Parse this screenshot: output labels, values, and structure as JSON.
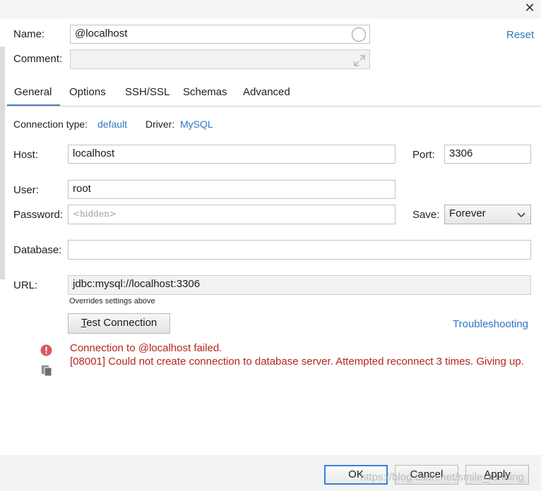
{
  "window": {
    "close": "✕"
  },
  "name": {
    "label": "Name:",
    "value": "@localhost"
  },
  "comment": {
    "label": "Comment:",
    "value": ""
  },
  "reset": "Reset",
  "tabs": [
    "General",
    "Options",
    "SSH/SSL",
    "Schemas",
    "Advanced"
  ],
  "connection": {
    "type_label": "Connection type:",
    "type_value": "default",
    "driver_label": "Driver:",
    "driver_value": "MySQL"
  },
  "host": {
    "label": "Host:",
    "value": "localhost"
  },
  "port": {
    "label": "Port:",
    "value": "3306"
  },
  "user": {
    "label": "User:",
    "value": "root"
  },
  "password": {
    "label": "Password:",
    "placeholder": "<hidden>"
  },
  "save": {
    "label": "Save:",
    "selected": "Forever"
  },
  "database": {
    "label": "Database:",
    "value": ""
  },
  "url": {
    "label": "URL:",
    "value": "jdbc:mysql://localhost:3306",
    "note": "Overrides settings above"
  },
  "test_connection": {
    "mnemonic": "T",
    "rest": "est Connection"
  },
  "troubleshooting": "Troubleshooting",
  "error": {
    "line1": "Connection to @localhost failed.",
    "line2": "[08001] Could not create connection to database server. Attempted reconnect 3 times. Giving up."
  },
  "footer": {
    "ok": "OK",
    "cancel": "Cancel",
    "apply_mnemonic": "A",
    "apply_rest": "pply"
  },
  "watermark": "https://blog.csdn.net/smile_running",
  "colors": {
    "accent": "#2f76c1",
    "error": "#b3261e",
    "default_button_border": "#3d7fd6"
  }
}
